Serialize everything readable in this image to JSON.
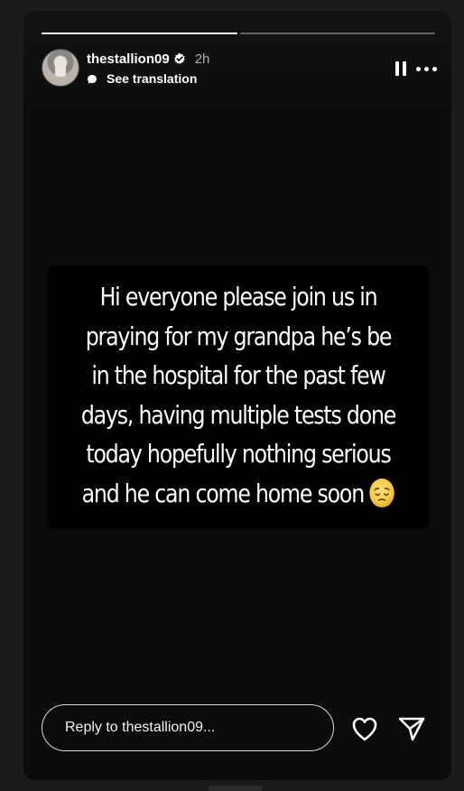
{
  "story": {
    "progress": [
      {
        "fill": 1.0
      },
      {
        "fill": 0.0
      }
    ],
    "header": {
      "username": "thestallion09",
      "time": "2h",
      "see_translation": "See translation",
      "avatar_icon": "profile-photo",
      "verified_icon": "verified-badge-icon"
    },
    "controls": {
      "pause_icon": "pause-icon",
      "more_icon": "more-options-icon"
    },
    "caption": {
      "lines": [
        "Hi everyone please join us in",
        "praying for my grandpa he’s be",
        "in the hospital for the past few",
        "days, having multiple tests done",
        "today hopefully nothing serious",
        "and he can come home soon"
      ],
      "emoji": "pensive-face-emoji"
    },
    "footer": {
      "reply_placeholder": "Reply to thestallion09...",
      "like_icon": "heart-icon",
      "share_icon": "send-icon"
    }
  },
  "colors": {
    "background": "#1b1b1b",
    "story_background": "#0b0b0b",
    "text": "#ffffff",
    "muted_text": "#b0b0b0",
    "emoji_yellow": "#f9c947"
  }
}
